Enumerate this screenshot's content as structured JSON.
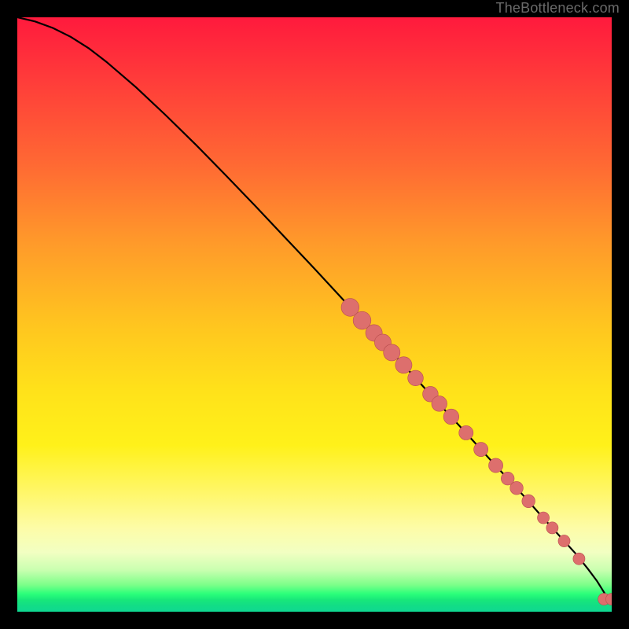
{
  "watermark": "TheBottleneck.com",
  "colors": {
    "line": "#000000",
    "dot_fill": "#dd6f6d",
    "dot_stroke": "#b94f4f"
  },
  "chart_data": {
    "type": "line",
    "title": "",
    "xlabel": "",
    "ylabel": "",
    "xlim": [
      0,
      100
    ],
    "ylim": [
      0,
      100
    ],
    "grid": false,
    "legend": false,
    "series": [
      {
        "name": "curve",
        "x": [
          0,
          3,
          6,
          9,
          12,
          15,
          20,
          25,
          30,
          35,
          40,
          45,
          50,
          55,
          60,
          65,
          70,
          75,
          80,
          85,
          88,
          91,
          94,
          96,
          97.5,
          98.5,
          99.3,
          100
        ],
        "y": [
          100,
          99.3,
          98.2,
          96.7,
          94.8,
          92.5,
          88.2,
          83.5,
          78.6,
          73.5,
          68.3,
          63.0,
          57.7,
          52.3,
          46.9,
          41.5,
          36.0,
          30.6,
          25.1,
          19.7,
          16.3,
          13.0,
          9.7,
          7.2,
          5.2,
          3.6,
          2.3,
          2.1
        ]
      }
    ],
    "dots": [
      {
        "x": 56,
        "y": 51.2,
        "r": 1.5
      },
      {
        "x": 58,
        "y": 49.0,
        "r": 1.5
      },
      {
        "x": 60,
        "y": 46.9,
        "r": 1.4
      },
      {
        "x": 61.5,
        "y": 45.3,
        "r": 1.4
      },
      {
        "x": 63,
        "y": 43.6,
        "r": 1.4
      },
      {
        "x": 65,
        "y": 41.5,
        "r": 1.4
      },
      {
        "x": 67,
        "y": 39.3,
        "r": 1.3
      },
      {
        "x": 69.5,
        "y": 36.6,
        "r": 1.3
      },
      {
        "x": 71,
        "y": 35.0,
        "r": 1.3
      },
      {
        "x": 73,
        "y": 32.8,
        "r": 1.3
      },
      {
        "x": 75.5,
        "y": 30.1,
        "r": 1.2
      },
      {
        "x": 78,
        "y": 27.3,
        "r": 1.2
      },
      {
        "x": 80.5,
        "y": 24.6,
        "r": 1.2
      },
      {
        "x": 82.5,
        "y": 22.4,
        "r": 1.1
      },
      {
        "x": 84,
        "y": 20.8,
        "r": 1.1
      },
      {
        "x": 86,
        "y": 18.6,
        "r": 1.1
      },
      {
        "x": 88.5,
        "y": 15.8,
        "r": 1.0
      },
      {
        "x": 90,
        "y": 14.1,
        "r": 1.0
      },
      {
        "x": 92,
        "y": 11.9,
        "r": 1.0
      },
      {
        "x": 94.5,
        "y": 8.9,
        "r": 1.0
      },
      {
        "x": 98.7,
        "y": 2.1,
        "r": 1.0
      },
      {
        "x": 100,
        "y": 2.1,
        "r": 1.0
      }
    ]
  }
}
